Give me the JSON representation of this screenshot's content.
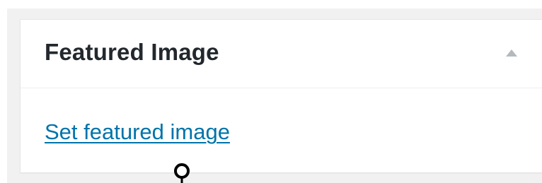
{
  "metabox": {
    "title": "Featured Image",
    "link_label": "Set featured image",
    "toggle_icon": "triangle-up-icon"
  },
  "colors": {
    "title_text": "#23282d",
    "link": "#0073aa",
    "toggle_arrow": "#b4b9be",
    "page_background": "#f1f1f1",
    "panel_background": "#ffffff",
    "panel_border": "#e5e5e5"
  },
  "cursor_icon": "mouse-cursor-icon"
}
